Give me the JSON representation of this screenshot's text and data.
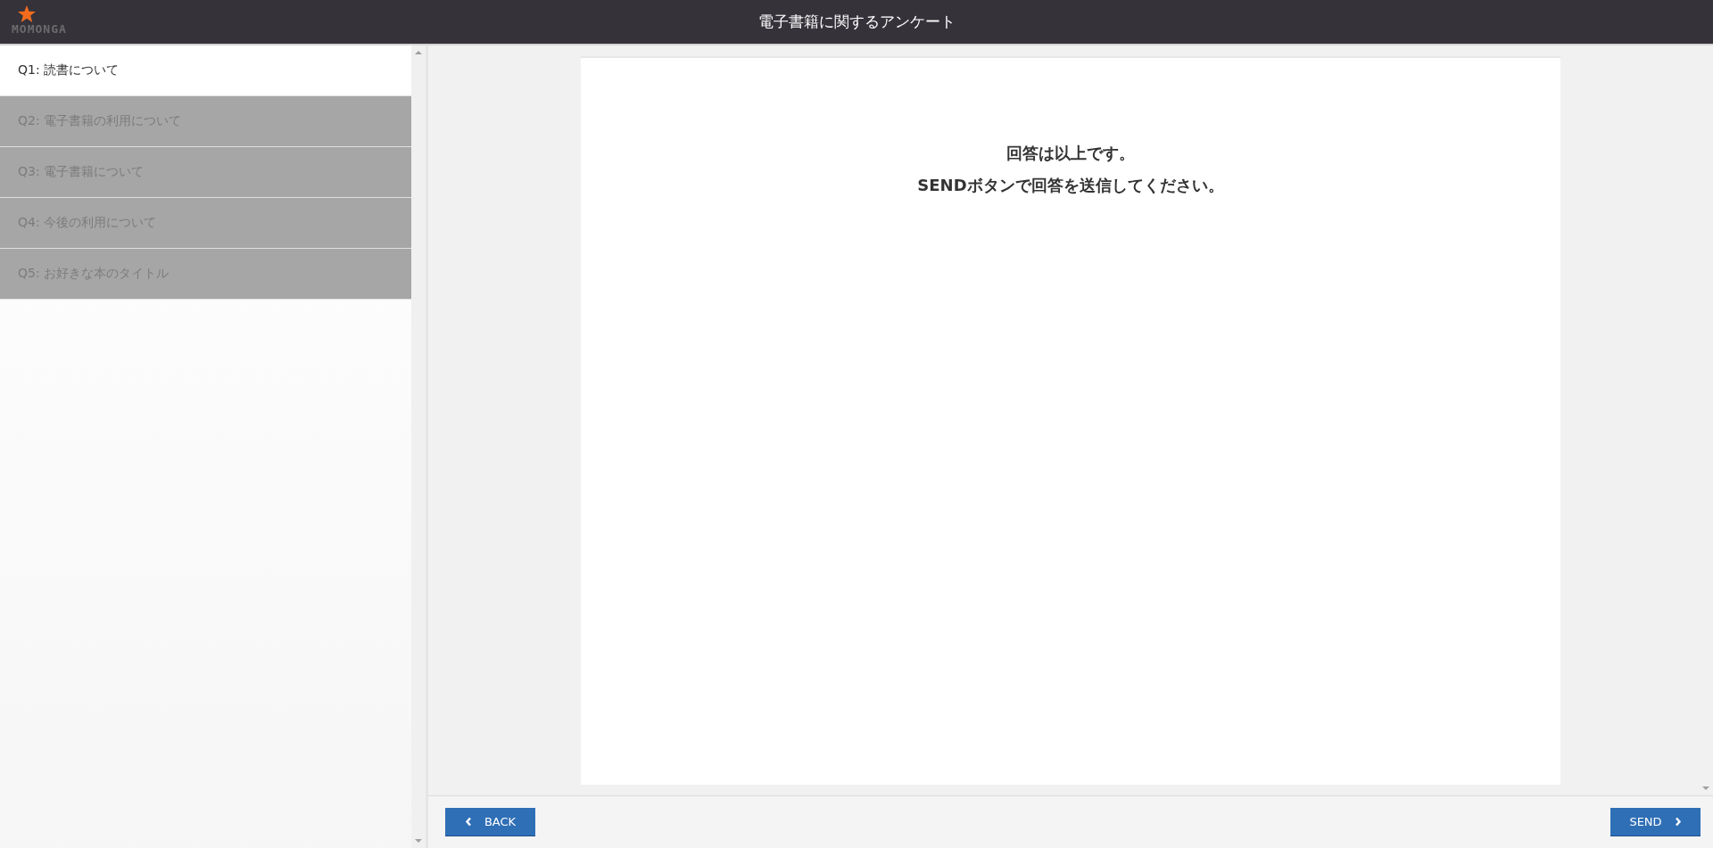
{
  "header": {
    "logo": "MOMONGA",
    "title": "電子書籍に関するアンケート"
  },
  "sidebar": {
    "items": [
      {
        "label": "Q1: 読書について",
        "selected": true
      },
      {
        "label": "Q2: 電子書籍の利用について",
        "selected": false
      },
      {
        "label": "Q3: 電子書籍について",
        "selected": false
      },
      {
        "label": "Q4: 今後の利用について",
        "selected": false
      },
      {
        "label": "Q5: お好きな本のタイトル",
        "selected": false
      }
    ]
  },
  "content": {
    "lines": [
      "回答は以上です。",
      "SENDボタンで回答を送信してください。"
    ]
  },
  "footer": {
    "back": "BACK",
    "send": "SEND"
  }
}
